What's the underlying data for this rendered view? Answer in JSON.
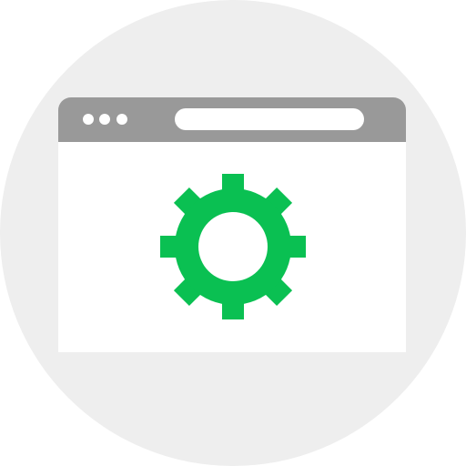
{
  "colors": {
    "background_circle": "#eeeeee",
    "window_frame": "#999999",
    "window_content": "#ffffff",
    "title_dots": "#ffffff",
    "address_bar": "#ffffff",
    "gear": "#0ac052",
    "gear_hole": "#ffffff"
  },
  "icons": {
    "main": "gear-icon",
    "window": "browser-window-icon"
  }
}
